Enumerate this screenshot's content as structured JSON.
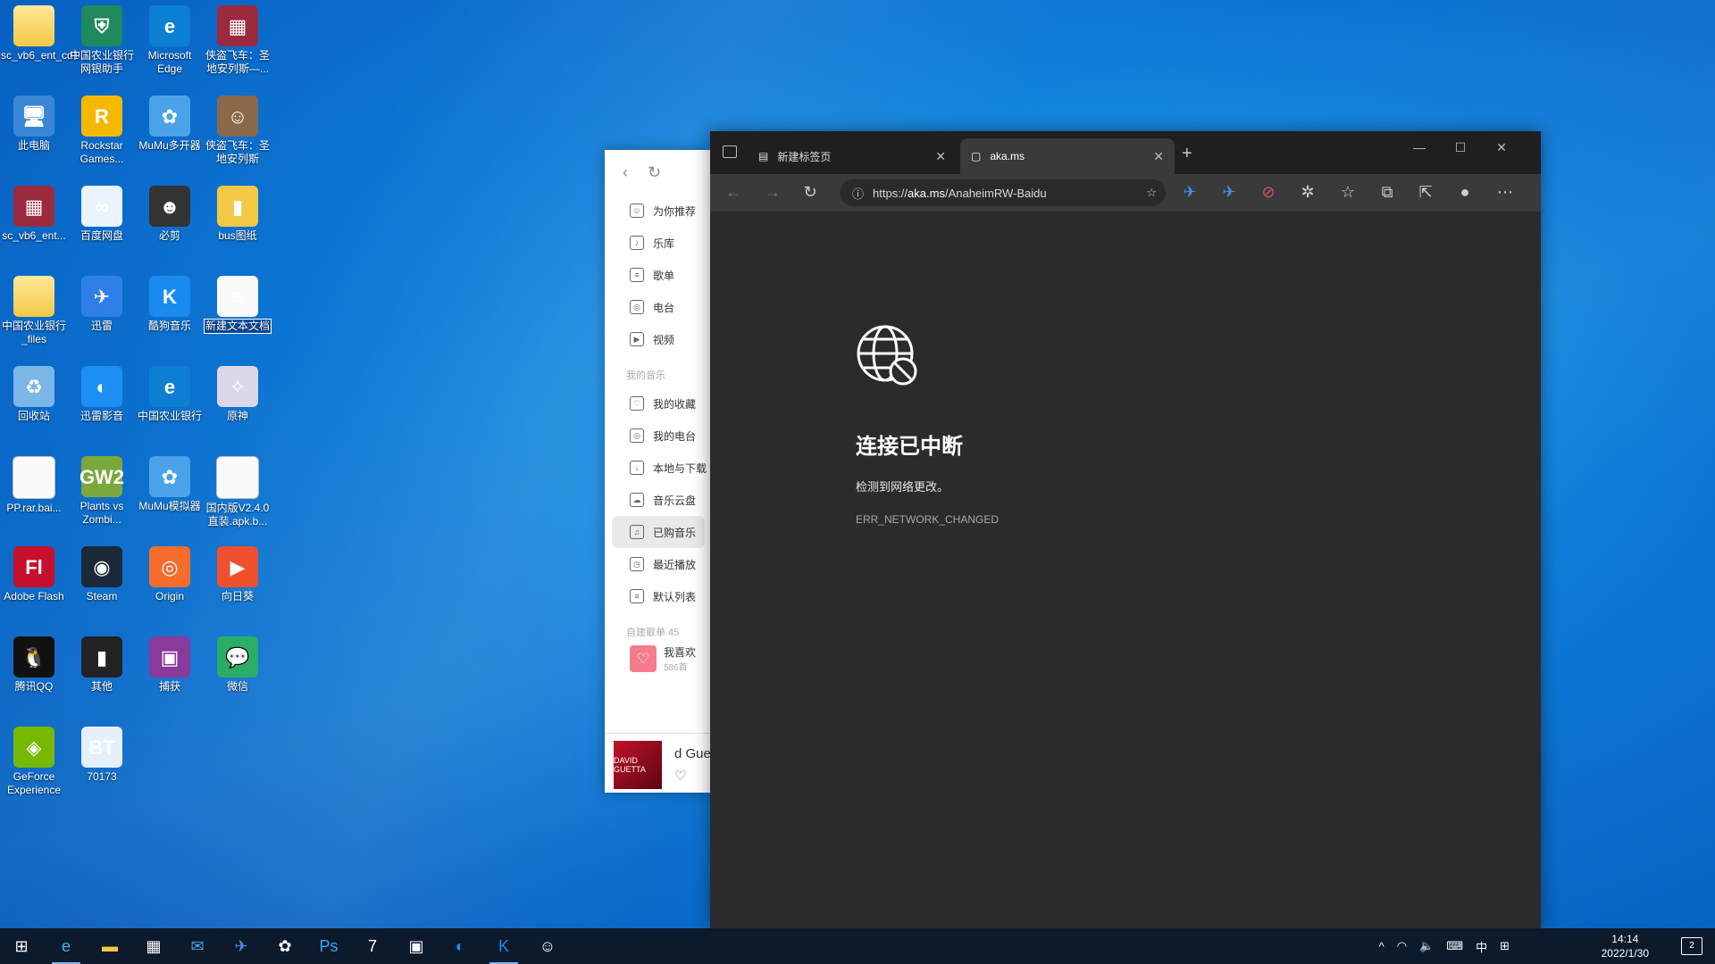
{
  "desktop": {
    "icons": [
      {
        "label": "sc_vb6_ent_cd1",
        "glyph": "",
        "color": "#f3c844"
      },
      {
        "label": "中国农业银行网银助手",
        "glyph": "⛨",
        "color": "#1f8a5b"
      },
      {
        "label": "Microsoft Edge",
        "glyph": "e",
        "color": "#0c7fd0"
      },
      {
        "label": "侠盗飞车：圣地安列斯—...",
        "glyph": "▦",
        "color": "#9b2a3e"
      },
      {
        "label": "此电脑",
        "glyph": "🖥",
        "color": "#3a86d6"
      },
      {
        "label": "Rockstar Games...",
        "glyph": "R",
        "color": "#f5b800"
      },
      {
        "label": "MuMu多开器",
        "glyph": "✿",
        "color": "#4aa3e8"
      },
      {
        "label": "侠盗飞车：圣地安列斯",
        "glyph": "☺",
        "color": "#8a6a4a"
      },
      {
        "label": "sc_vb6_ent...",
        "glyph": "▦",
        "color": "#9b2a3e"
      },
      {
        "label": "百度网盘",
        "glyph": "∞",
        "color": "#eaf4ff"
      },
      {
        "label": "必剪",
        "glyph": "☻",
        "color": "#333333"
      },
      {
        "label": "bus图纸",
        "glyph": "▮",
        "color": "#f3c844"
      },
      {
        "label": "中国农业银行_files",
        "glyph": "",
        "color": "#f3c844"
      },
      {
        "label": "迅雷",
        "glyph": "✈",
        "color": "#2f7fe8"
      },
      {
        "label": "酷狗音乐",
        "glyph": "K",
        "color": "#1a8cf0"
      },
      {
        "label": "新建文本文档",
        "glyph": "≡",
        "color": "#fafafa"
      },
      {
        "label": "回收站",
        "glyph": "♻",
        "color": "#7bb6e8"
      },
      {
        "label": "迅雷影音",
        "glyph": "◐",
        "color": "#1d8ef3"
      },
      {
        "label": "中国农业银行",
        "glyph": "e",
        "color": "#0c7fd0"
      },
      {
        "label": "原神",
        "glyph": "✧",
        "color": "#dcd6e8"
      },
      {
        "label": "PP.rar.bai...",
        "glyph": "",
        "color": "#fafafa"
      },
      {
        "label": "Plants vs Zombi...",
        "glyph": "GW2",
        "color": "#7aa83a"
      },
      {
        "label": "MuMu模拟器",
        "glyph": "✿",
        "color": "#4aa3e8"
      },
      {
        "label": "国内版V2.4.0直装.apk.b...",
        "glyph": "",
        "color": "#fafafa"
      },
      {
        "label": "Adobe Flash",
        "glyph": "Fl",
        "color": "#c8102e"
      },
      {
        "label": "Steam",
        "glyph": "◉",
        "color": "#1b2838"
      },
      {
        "label": "Origin",
        "glyph": "◎",
        "color": "#f56c2d"
      },
      {
        "label": "向日葵",
        "glyph": "▶",
        "color": "#f0502e"
      },
      {
        "label": "腾讯QQ",
        "glyph": "🐧",
        "color": "#111111"
      },
      {
        "label": "其他",
        "glyph": "▮",
        "color": "#222222"
      },
      {
        "label": "捕获",
        "glyph": "▣",
        "color": "#8a3a9a"
      },
      {
        "label": "微信",
        "glyph": "💬",
        "color": "#2aae67"
      },
      {
        "label": "GeForce Experience",
        "glyph": "◈",
        "color": "#76b900"
      },
      {
        "label": "70173",
        "glyph": "BT",
        "color": "#e6f0fb"
      }
    ]
  },
  "music": {
    "nav": [
      {
        "label": "为你推荐",
        "icon": "☺"
      },
      {
        "label": "乐库",
        "icon": "♪"
      },
      {
        "label": "歌单",
        "icon": "≡"
      },
      {
        "label": "电台",
        "icon": "◎"
      },
      {
        "label": "视频",
        "icon": "▶"
      }
    ],
    "my_music_header": "我的音乐",
    "my_music": [
      {
        "label": "我的收藏",
        "icon": "♡"
      },
      {
        "label": "我的电台",
        "icon": "◎"
      },
      {
        "label": "本地与下载",
        "icon": "↓"
      },
      {
        "label": "音乐云盘",
        "icon": "☁"
      },
      {
        "label": "已购音乐",
        "icon": "♫"
      },
      {
        "label": "最近播放",
        "icon": "◷"
      },
      {
        "label": "默认列表",
        "icon": "≡"
      }
    ],
    "playlists_header": "自建歌单 45",
    "playlist_name": "我喜欢",
    "playlist_count": "586首",
    "now_playing_fragment": "d Gue",
    "album_text": "DAVID GUETTA"
  },
  "browser": {
    "tabs": [
      {
        "label": "新建标签页"
      },
      {
        "label": "aka.ms"
      }
    ],
    "url_prefix": "https://",
    "url_host": "aka.ms",
    "url_path": "/AnaheimRW-Baidu",
    "error_title": "连接已中断",
    "error_message": "检测到网络更改。",
    "error_code": "ERR_NETWORK_CHANGED"
  },
  "taskbar": {
    "ime": "中",
    "time": "14:14",
    "date": "2022/1/30",
    "notifications": "2"
  }
}
